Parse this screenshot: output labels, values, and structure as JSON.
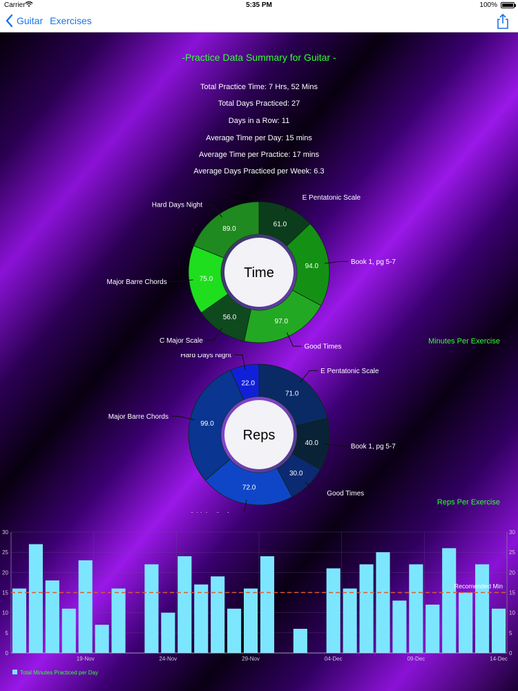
{
  "status_bar": {
    "carrier": "Carrier",
    "time": "5:35 PM",
    "battery": "100%"
  },
  "nav": {
    "back_label": "Guitar",
    "title": "Exercises"
  },
  "summary": {
    "title": "-Practice Data Summary for Guitar -",
    "stats": [
      "Total Practice Time: 7 Hrs, 52 Mins",
      "Total Days Practiced: 27",
      "Days in a Row: 11",
      "Average Time per Day: 15 mins",
      "Average Time per Practice: 17 mins",
      "Average Days Practiced per Week: 6.3"
    ]
  },
  "chart_data": [
    {
      "type": "pie",
      "center_label": "Time",
      "description": "Minutes Per Exercise",
      "slices": [
        {
          "label": "E Pentatonic Scale",
          "value": 61.0,
          "color": "#0b3d1c"
        },
        {
          "label": "Book 1, pg 5-7",
          "value": 94.0,
          "color": "#149114"
        },
        {
          "label": "Good Times",
          "value": 97.0,
          "color": "#23a823"
        },
        {
          "label": "C Major Scale",
          "value": 56.0,
          "color": "#0f4a1e"
        },
        {
          "label": "Major Barre Chords",
          "value": 75.0,
          "color": "#1ede1e"
        },
        {
          "label": "Hard Days Night",
          "value": 89.0,
          "color": "#1f8a1f"
        }
      ]
    },
    {
      "type": "pie",
      "center_label": "Reps",
      "description": "Reps Per Exercise",
      "slices": [
        {
          "label": "E Pentatonic Scale",
          "value": 71.0,
          "color": "#0a2a66"
        },
        {
          "label": "Book 1, pg 5-7",
          "value": 40.0,
          "color": "#0a2236"
        },
        {
          "label": "Good Times",
          "value": 30.0,
          "color": "#0c2a72"
        },
        {
          "label": "C Major Scale",
          "value": 72.0,
          "color": "#0f46c8"
        },
        {
          "label": "Major Barre Chords",
          "value": 99.0,
          "color": "#0a3590"
        },
        {
          "label": "Hard Days Night",
          "value": 22.0,
          "color": "#1020d8"
        }
      ]
    },
    {
      "type": "bar",
      "legend": "Total Minutes Practiced per Day",
      "ylim": [
        0,
        30
      ],
      "yticks": [
        0,
        5,
        10,
        15,
        20,
        25,
        30
      ],
      "limit_label": "Recomended Min",
      "limit_value": 15,
      "values": [
        16,
        27,
        18,
        11,
        23,
        7,
        16,
        0,
        22,
        10,
        24,
        17,
        19,
        11,
        16,
        24,
        0,
        6,
        0,
        21,
        16,
        22,
        25,
        13,
        22,
        12,
        26,
        15,
        22,
        11
      ],
      "x_labels": [
        {
          "index": 4,
          "label": "19-Nov"
        },
        {
          "index": 9,
          "label": "24-Nov"
        },
        {
          "index": 14,
          "label": "29-Nov"
        },
        {
          "index": 19,
          "label": "04-Dec"
        },
        {
          "index": 24,
          "label": "09-Dec"
        },
        {
          "index": 29,
          "label": "14-Dec"
        }
      ],
      "bar_color": "#7de6ff",
      "limit_color": "#e05a2e"
    }
  ]
}
